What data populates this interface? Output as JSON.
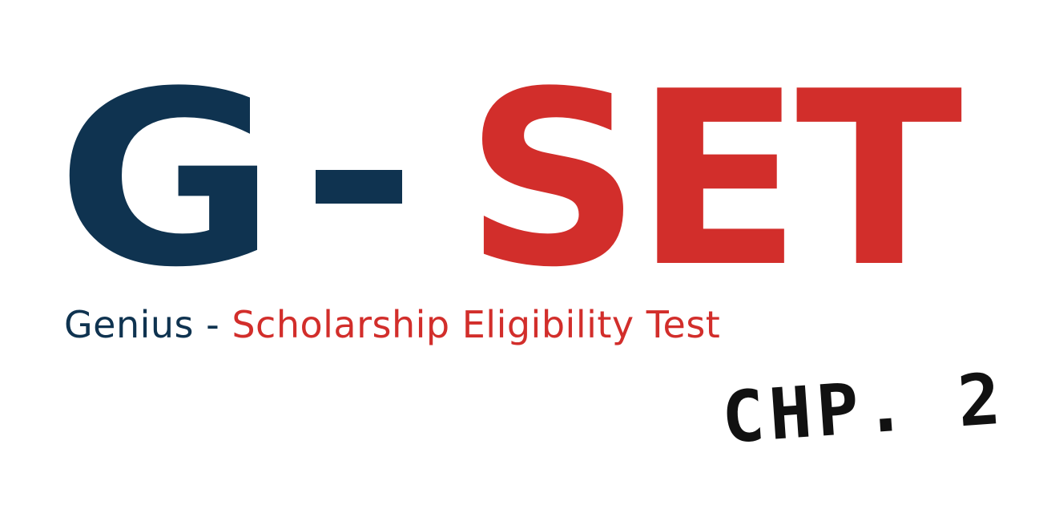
{
  "logo": {
    "letter_g": "G",
    "letters_set": "SET",
    "color_primary": "#0f3350",
    "color_accent": "#d22e2b"
  },
  "tagline": {
    "genius": "Genius -",
    "rest": "Scholarship Eligibility Test"
  },
  "chapter": {
    "label": "CHP. 2",
    "color": "#111111"
  }
}
